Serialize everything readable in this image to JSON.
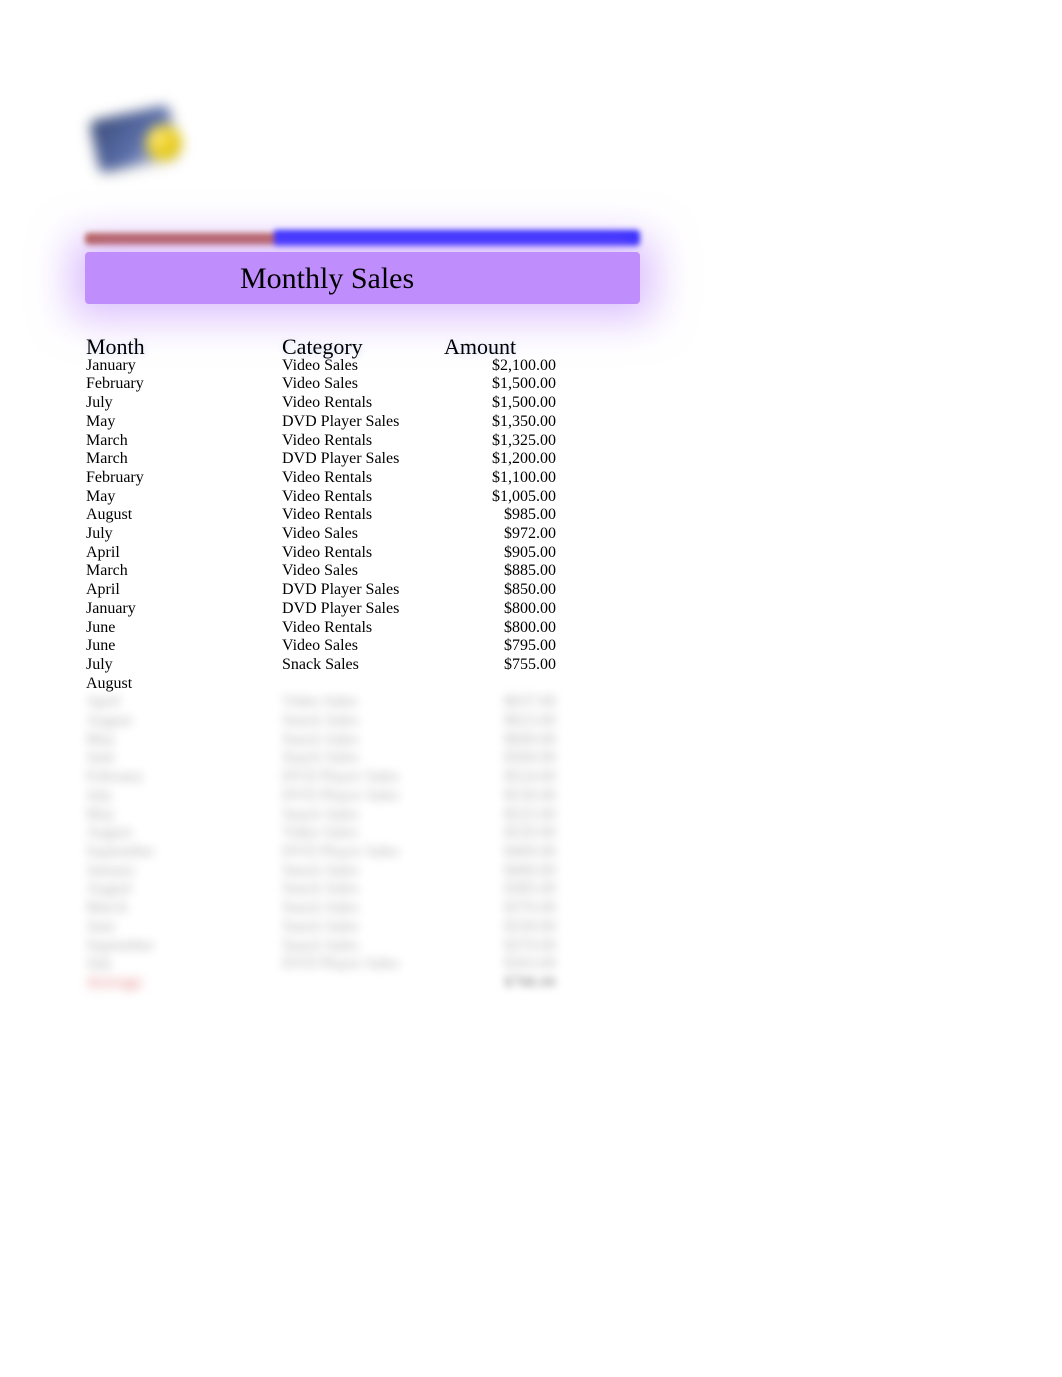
{
  "title": "Monthly Sales",
  "columns": {
    "month": "Month",
    "category": "Category",
    "amount": "Amount"
  },
  "rows": [
    {
      "month": "January",
      "category": "Video Sales",
      "amount": "$2,100.00"
    },
    {
      "month": "February",
      "category": "Video Sales",
      "amount": "$1,500.00"
    },
    {
      "month": "July",
      "category": "Video Rentals",
      "amount": "$1,500.00"
    },
    {
      "month": "May",
      "category": "DVD Player Sales",
      "amount": "$1,350.00"
    },
    {
      "month": "March",
      "category": "Video Rentals",
      "amount": "$1,325.00"
    },
    {
      "month": "March",
      "category": "DVD Player Sales",
      "amount": "$1,200.00"
    },
    {
      "month": "February",
      "category": "Video Rentals",
      "amount": "$1,100.00"
    },
    {
      "month": "May",
      "category": "Video Rentals",
      "amount": "$1,005.00"
    },
    {
      "month": "August",
      "category": "Video Rentals",
      "amount": "$985.00"
    },
    {
      "month": "July",
      "category": "Video Sales",
      "amount": "$972.00"
    },
    {
      "month": "April",
      "category": "Video Rentals",
      "amount": "$905.00"
    },
    {
      "month": "March",
      "category": "Video Sales",
      "amount": "$885.00"
    },
    {
      "month": "April",
      "category": "DVD Player Sales",
      "amount": "$850.00"
    },
    {
      "month": "January",
      "category": "DVD Player Sales",
      "amount": "$800.00"
    },
    {
      "month": "June",
      "category": "Video Rentals",
      "amount": "$800.00"
    },
    {
      "month": "June",
      "category": "Video Sales",
      "amount": "$795.00"
    },
    {
      "month": "July",
      "category": "Snack Sales",
      "amount": "$755.00"
    },
    {
      "month": "August",
      "category": "",
      "amount": ""
    }
  ],
  "blurred_rows": [
    {
      "month": "April",
      "category": "Video Sales",
      "amount": "$637.00"
    },
    {
      "month": "August",
      "category": "Snack Sales",
      "amount": "$623.00"
    },
    {
      "month": "May",
      "category": "Snack Sales",
      "amount": "$600.00"
    },
    {
      "month": "June",
      "category": "Snack Sales",
      "amount": "$560.00"
    },
    {
      "month": "February",
      "category": "DVD Player Sales",
      "amount": "$524.00"
    },
    {
      "month": "July",
      "category": "DVD Player Sales",
      "amount": "$530.00"
    },
    {
      "month": "May",
      "category": "Snack Sales",
      "amount": "$525.00"
    },
    {
      "month": "August",
      "category": "Video Sales",
      "amount": "$520.00"
    },
    {
      "month": "September",
      "category": "DVD Player Sales",
      "amount": "$400.00"
    },
    {
      "month": "January",
      "category": "Snack Sales",
      "amount": "$400.00"
    },
    {
      "month": "August",
      "category": "Snack Sales",
      "amount": "$385.00"
    },
    {
      "month": "March",
      "category": "Snack Sales",
      "amount": "$376.00"
    },
    {
      "month": "June",
      "category": "Snack Sales",
      "amount": "$330.00"
    },
    {
      "month": "September",
      "category": "Snack Sales",
      "amount": "$370.00"
    },
    {
      "month": "July",
      "category": "DVD Player Sales",
      "amount": "$263.00"
    }
  ],
  "summary": {
    "label": "Average",
    "amount": "$788.00"
  }
}
